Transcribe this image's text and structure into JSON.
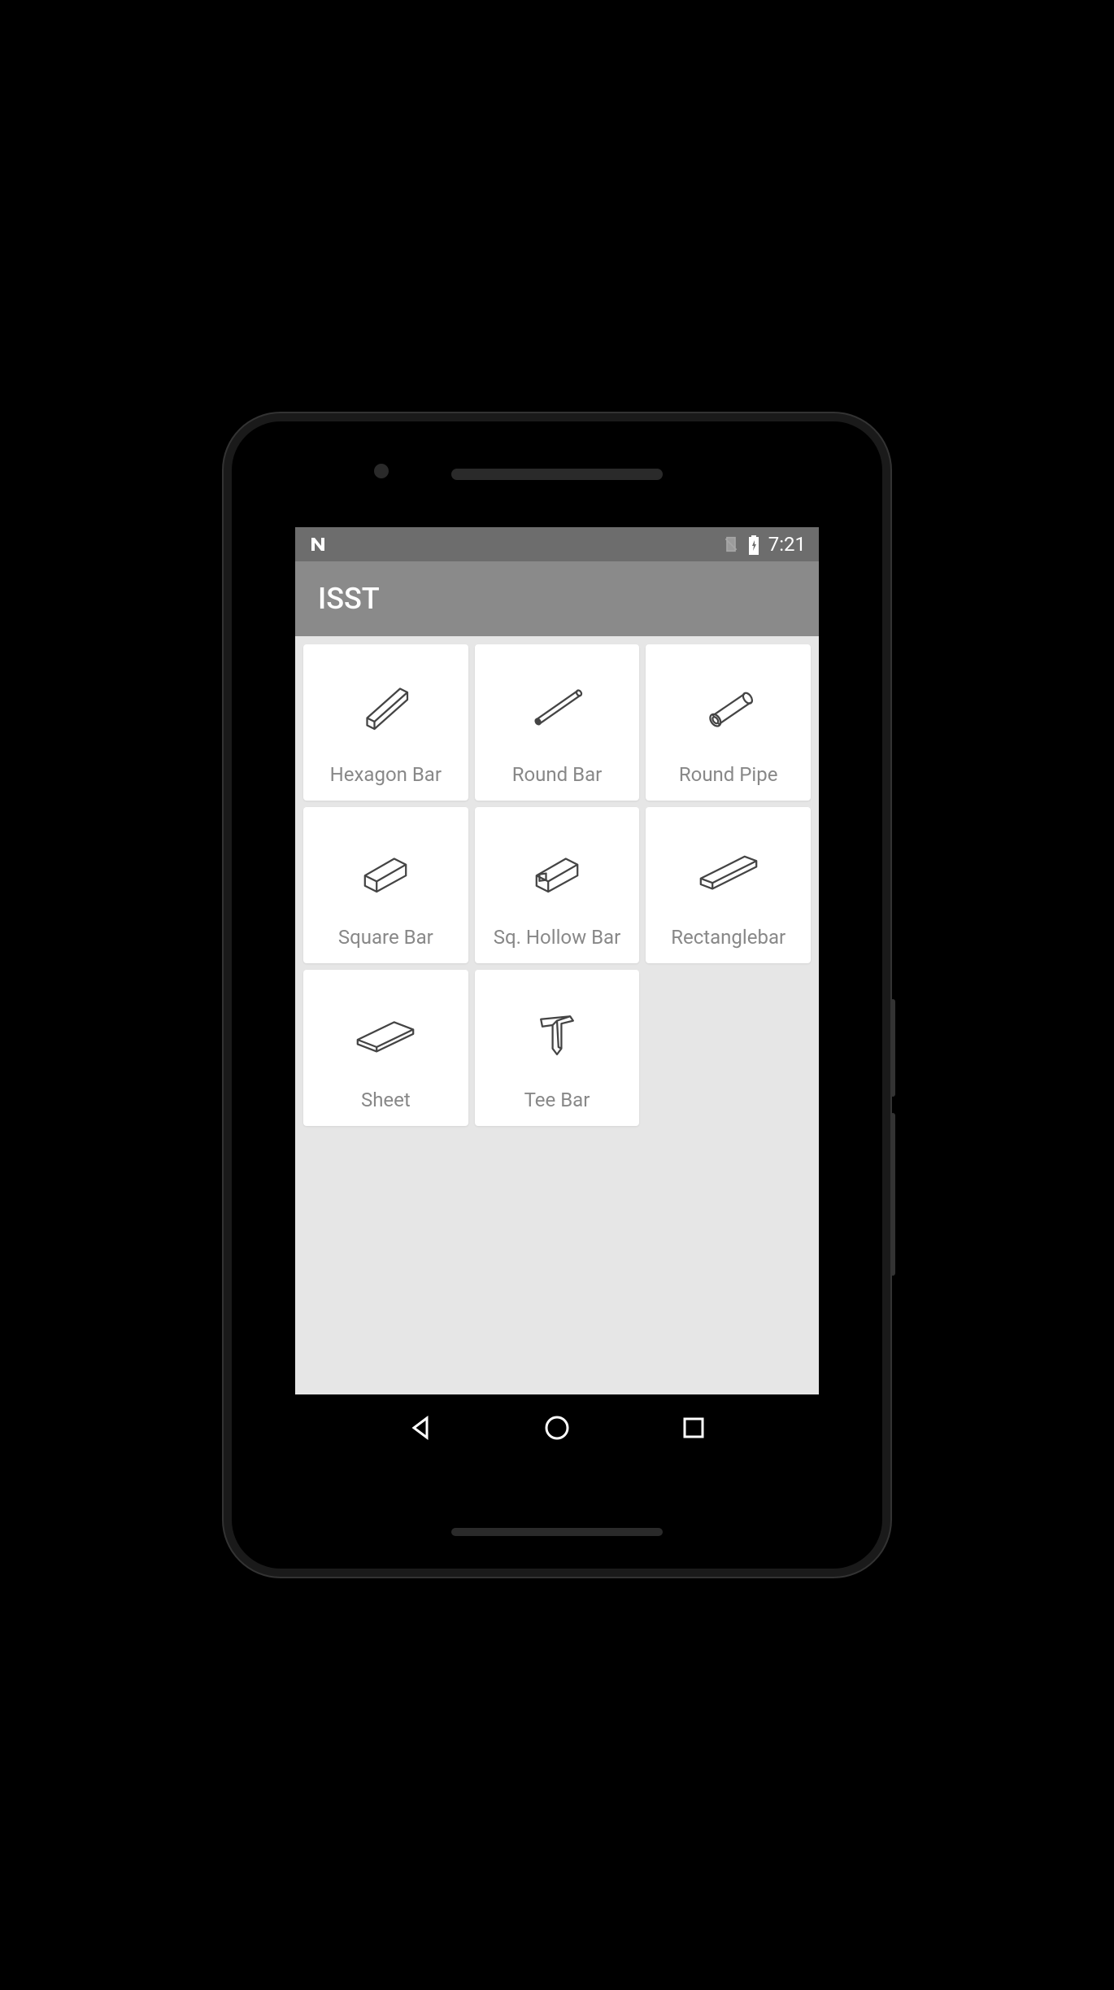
{
  "status_bar": {
    "time": "7:21"
  },
  "app_bar": {
    "title": "ISST"
  },
  "tiles": [
    {
      "label": "Hexagon Bar",
      "icon": "hexagon-bar-icon"
    },
    {
      "label": "Round Bar",
      "icon": "round-bar-icon"
    },
    {
      "label": "Round Pipe",
      "icon": "round-pipe-icon"
    },
    {
      "label": "Square Bar",
      "icon": "square-bar-icon"
    },
    {
      "label": "Sq. Hollow Bar",
      "icon": "sq-hollow-bar-icon"
    },
    {
      "label": "Rectanglebar",
      "icon": "rectangle-bar-icon"
    },
    {
      "label": "Sheet",
      "icon": "sheet-icon"
    },
    {
      "label": "Tee Bar",
      "icon": "tee-bar-icon"
    }
  ]
}
